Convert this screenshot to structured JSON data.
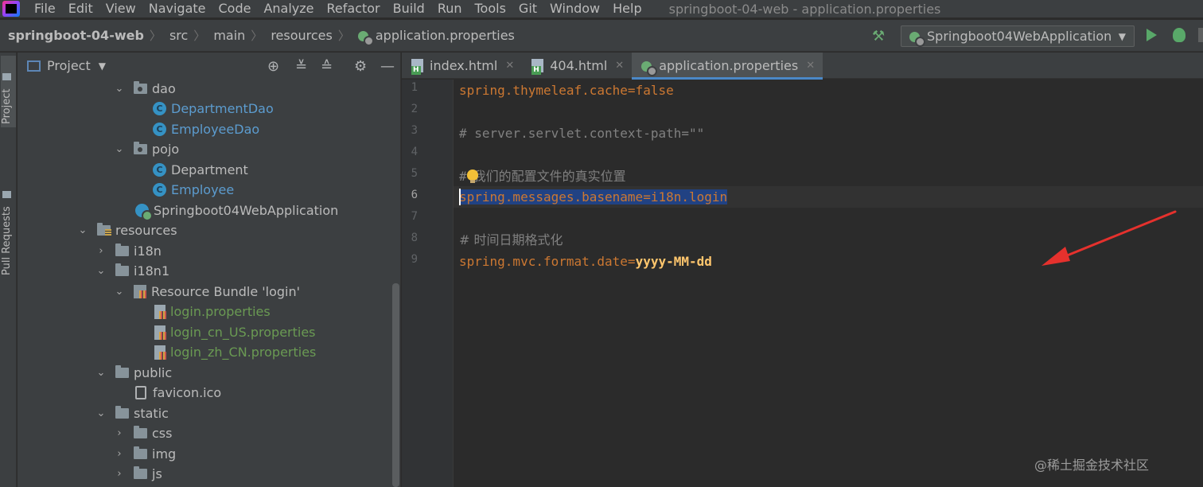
{
  "menu": {
    "items": [
      "File",
      "Edit",
      "View",
      "Navigate",
      "Code",
      "Analyze",
      "Refactor",
      "Build",
      "Run",
      "Tools",
      "Git",
      "Window",
      "Help"
    ],
    "window_title": "springboot-04-web - application.properties"
  },
  "breadcrumb": {
    "project": "springboot-04-web",
    "parts": [
      "src",
      "main",
      "resources"
    ],
    "file": "application.properties"
  },
  "run_config": {
    "label": "Springboot04WebApplication"
  },
  "left_strip": {
    "project_tab": "Project",
    "pull_requests_tab": "Pull Requests"
  },
  "project_panel": {
    "title": "Project",
    "tree": [
      {
        "label": "dao",
        "depth": 5
      },
      {
        "label": "DepartmentDao",
        "depth": 6
      },
      {
        "label": "EmployeeDao",
        "depth": 6
      },
      {
        "label": "pojo",
        "depth": 5
      },
      {
        "label": "Department",
        "depth": 6
      },
      {
        "label": "Employee",
        "depth": 6
      },
      {
        "label": "Springboot04WebApplication",
        "depth": 5
      },
      {
        "label": "resources",
        "depth": 3
      },
      {
        "label": "i18n",
        "depth": 4
      },
      {
        "label": "i18n1",
        "depth": 4
      },
      {
        "label": "Resource Bundle 'login'",
        "depth": 5
      },
      {
        "label": "login.properties",
        "depth": 6
      },
      {
        "label": "login_cn_US.properties",
        "depth": 6
      },
      {
        "label": "login_zh_CN.properties",
        "depth": 6
      },
      {
        "label": "public",
        "depth": 4
      },
      {
        "label": "favicon.ico",
        "depth": 5
      },
      {
        "label": "static",
        "depth": 4
      },
      {
        "label": "css",
        "depth": 5
      },
      {
        "label": "img",
        "depth": 5
      },
      {
        "label": "js",
        "depth": 5
      }
    ]
  },
  "tabs": [
    {
      "label": "index.html"
    },
    {
      "label": "404.html"
    },
    {
      "label": "application.properties"
    }
  ],
  "editor": {
    "line_numbers": [
      "1",
      "2",
      "3",
      "4",
      "5",
      "6",
      "7",
      "8",
      "9"
    ],
    "line1_key": "spring.thymeleaf.cache",
    "line1_eq": "=",
    "line1_value": "false",
    "line3_comment": "# server.servlet.context-path=\"\"",
    "line5_comment_hash": "#",
    "line5_comment_text": "我们的配置文件的真实位置",
    "line6_key": "spring.messages.basename",
    "line6_eq": "=",
    "line6_value": "i18n.login",
    "line8_comment": "# 时间日期格式化",
    "line9_key": "spring.mvc.format.date",
    "line9_eq": "=",
    "line9_value": "yyyy-MM-dd"
  },
  "watermark": "@稀土掘金技术社区",
  "colors": {
    "background": "#2b2b2b",
    "panel": "#3c3f41",
    "selection": "#214283",
    "key": "#cc7832",
    "comment": "#808080",
    "annotation_arrow": "#e5312d"
  }
}
